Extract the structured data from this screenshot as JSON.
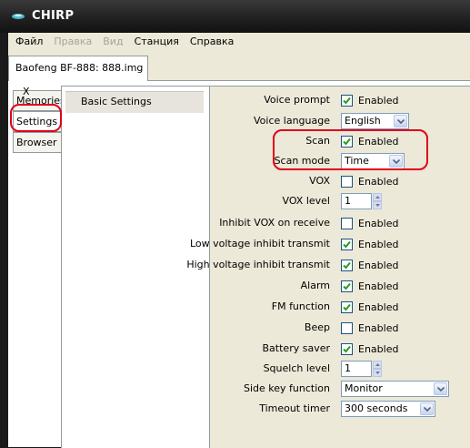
{
  "titlebar": {
    "title": "CHIRP",
    "icon": "chirp-radio-icon"
  },
  "menubar": [
    {
      "label": "Файл",
      "disabled": false
    },
    {
      "label": "Правка",
      "disabled": true
    },
    {
      "label": "Вид",
      "disabled": true
    },
    {
      "label": "Станция",
      "disabled": false
    },
    {
      "label": "Справка",
      "disabled": false
    }
  ],
  "file_tab": {
    "label": "Baofeng BF-888: 888.img",
    "close": "X"
  },
  "side_tabs": {
    "memories": "Memories",
    "settings": "Settings",
    "browser": "Browser",
    "active": "Settings"
  },
  "tree": {
    "basic_settings": "Basic Settings"
  },
  "settings": {
    "voice_prompt": {
      "label": "Voice prompt",
      "checked": true,
      "text": "Enabled"
    },
    "voice_language": {
      "label": "Voice language",
      "value": "English"
    },
    "scan": {
      "label": "Scan",
      "checked": true,
      "text": "Enabled"
    },
    "scan_mode": {
      "label": "Scan mode",
      "value": "Time"
    },
    "vox": {
      "label": "VOX",
      "checked": false,
      "text": "Enabled"
    },
    "vox_level": {
      "label": "VOX level",
      "value": "1"
    },
    "inhibit_vox": {
      "label": "Inhibit VOX on receive",
      "checked": false,
      "text": "Enabled"
    },
    "low_voltage": {
      "label": "Low voltage inhibit transmit",
      "checked": true,
      "text": "Enabled"
    },
    "high_voltage": {
      "label": "High voltage inhibit transmit",
      "checked": true,
      "text": "Enabled"
    },
    "alarm": {
      "label": "Alarm",
      "checked": true,
      "text": "Enabled"
    },
    "fm_function": {
      "label": "FM function",
      "checked": true,
      "text": "Enabled"
    },
    "beep": {
      "label": "Beep",
      "checked": false,
      "text": "Enabled"
    },
    "battery_saver": {
      "label": "Battery saver",
      "checked": true,
      "text": "Enabled"
    },
    "squelch_level": {
      "label": "Squelch level",
      "value": "1"
    },
    "side_key_function": {
      "label": "Side key function",
      "value": "Monitor"
    },
    "timeout_timer": {
      "label": "Timeout timer",
      "value": "300 seconds"
    }
  },
  "colors": {
    "highlight": "#e0001b",
    "checkbox_check": "#21a121",
    "window_bg": "#ece9d8"
  }
}
